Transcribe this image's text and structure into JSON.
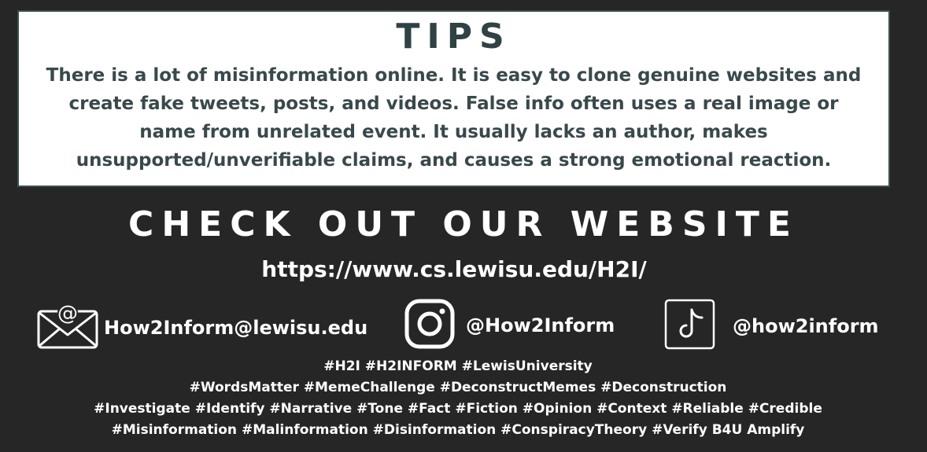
{
  "tips": {
    "title": "TIPS",
    "lines": [
      "There is a lot of misinformation online. It is easy to clone genuine websites and",
      "create fake tweets, posts, and videos. False info often uses a real image or",
      "name from unrelated event. It usually lacks an author, makes",
      "unsupported/unverifiable claims, and causes a strong emotional reaction."
    ]
  },
  "website": {
    "heading": "CHECK OUT OUR WEBSITE",
    "url": "https://www.cs.lewisu.edu/H2I/"
  },
  "contacts": {
    "email": {
      "icon": "envelope-icon",
      "label": "How2Inform@lewisu.edu"
    },
    "instagram": {
      "icon": "instagram-icon",
      "label": "@How2Inform"
    },
    "tiktok": {
      "icon": "tiktok-icon",
      "label": "@how2inform"
    }
  },
  "hashtags": [
    "#H2I #H2INFORM #LewisUniversity",
    "#WordsMatter #MemeChallenge #DeconstructMemes #Deconstruction",
    "#Investigate #Identify #Narrative #Tone #Fact #Fiction #Opinion #Context #Reliable #Credible",
    "#Misinformation #Malinformation #Disinformation #ConspiracyTheory #Verify B4U Amplify"
  ],
  "colors": {
    "background": "#262626",
    "tips_box": "#ffffff",
    "tips_text": "#39494b",
    "text": "#ffffff"
  }
}
